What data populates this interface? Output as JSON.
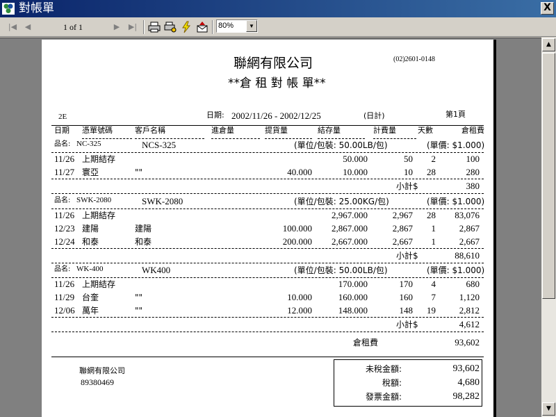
{
  "window": {
    "title": "對帳單",
    "close_glyph": "X"
  },
  "toolbar": {
    "page_info": "1 of 1",
    "zoom": "80%",
    "icons": [
      "first-page-icon",
      "prev-page-icon",
      "next-page-icon",
      "last-page-icon",
      "print-icon",
      "print-setup-icon",
      "lightning-icon",
      "export-icon"
    ]
  },
  "report": {
    "company": "聯網有限公司",
    "phone": "(02)2601-0148",
    "title": "**倉 租 對 帳 單**",
    "code": "2E",
    "date_label": "日期:",
    "date_range": "2002/11/26 - 2002/12/25",
    "date_type": "(日計)",
    "page_no": "第1頁",
    "columns": [
      "日期",
      "憑單號碼",
      "客戶名稱",
      "進倉量",
      "提貨量",
      "結存量",
      "計費量",
      "天數",
      "倉租費"
    ],
    "product_label": "品名:",
    "subtotal_label": "小計$",
    "groups": [
      {
        "code": "NC-325",
        "name": "NCS-325",
        "unit": "(單位/包裝: 50.00LB/包)",
        "price": "(單價: $1.000)",
        "rows": [
          {
            "date": "11/26",
            "doc": "上期結存",
            "cust": "",
            "in": "",
            "out": "",
            "bal": "50.000",
            "bill": "50",
            "days": "2",
            "fee": "100"
          },
          {
            "date": "11/27",
            "doc": "寰亞",
            "cust": "\"\"",
            "in": "",
            "out": "40.000",
            "bal": "10.000",
            "bill": "10",
            "days": "28",
            "fee": "280"
          }
        ],
        "subtotal": "380"
      },
      {
        "code": "SWK-2080",
        "name": "SWK-2080",
        "unit": "(單位/包裝: 25.00KG/包)",
        "price": "(單價: $1.000)",
        "rows": [
          {
            "date": "11/26",
            "doc": "上期結存",
            "cust": "",
            "in": "",
            "out": "",
            "bal": "2,967.000",
            "bill": "2,967",
            "days": "28",
            "fee": "83,076"
          },
          {
            "date": "12/23",
            "doc": "建陽",
            "cust": "建陽",
            "in": "",
            "out": "100.000",
            "bal": "2,867.000",
            "bill": "2,867",
            "days": "1",
            "fee": "2,867"
          },
          {
            "date": "12/24",
            "doc": "和泰",
            "cust": "和泰",
            "in": "",
            "out": "200.000",
            "bal": "2,667.000",
            "bill": "2,667",
            "days": "1",
            "fee": "2,667"
          }
        ],
        "subtotal": "88,610"
      },
      {
        "code": "WK-400",
        "name": "WK400",
        "unit": "(單位/包裝: 50.00LB/包)",
        "price": "(單價: $1.000)",
        "rows": [
          {
            "date": "11/26",
            "doc": "上期結存",
            "cust": "",
            "in": "",
            "out": "",
            "bal": "170.000",
            "bill": "170",
            "days": "4",
            "fee": "680"
          },
          {
            "date": "11/29",
            "doc": "台奎",
            "cust": "\"\"",
            "in": "",
            "out": "10.000",
            "bal": "160.000",
            "bill": "160",
            "days": "7",
            "fee": "1,120"
          },
          {
            "date": "12/06",
            "doc": "萬年",
            "cust": "\"\"",
            "in": "",
            "out": "12.000",
            "bal": "148.000",
            "bill": "148",
            "days": "19",
            "fee": "2,812"
          }
        ],
        "subtotal": "4,612"
      }
    ],
    "rent_label": "倉租費",
    "rent_total": "93,602",
    "footer_company": "聯網有限公司",
    "footer_tax_id": "89380469",
    "summary": [
      {
        "label": "未稅金額:",
        "value": "93,602"
      },
      {
        "label": "稅額:",
        "value": "4,680"
      },
      {
        "label": "發票金額:",
        "value": "98,282"
      }
    ]
  }
}
